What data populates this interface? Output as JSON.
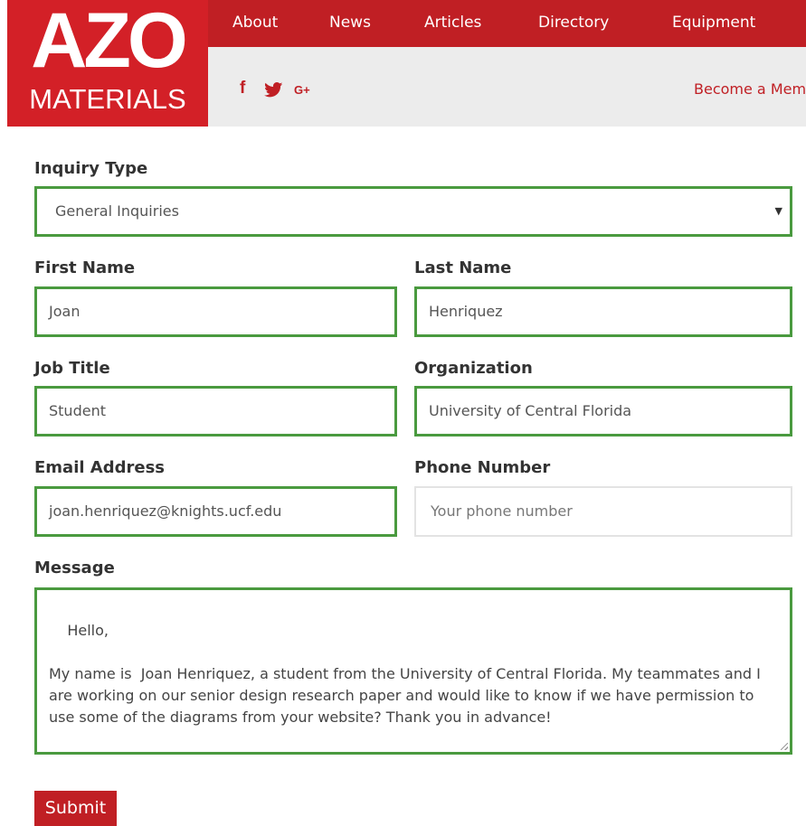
{
  "logo": {
    "brand_top": "AZO",
    "brand_bottom": "MATERIALS"
  },
  "nav": {
    "items": [
      "About",
      "News",
      "Articles",
      "Directory",
      "Equipment"
    ]
  },
  "subbar": {
    "social_icons": [
      "facebook-icon",
      "twitter-icon",
      "google-plus-icon"
    ],
    "facebook_glyph": "f",
    "google_glyph": "G+",
    "become_member": "Become a Mem"
  },
  "form": {
    "inquiry_type": {
      "label": "Inquiry Type",
      "value": "General Inquiries"
    },
    "first_name": {
      "label": "First Name",
      "value": "Joan"
    },
    "last_name": {
      "label": "Last Name",
      "value": "Henriquez"
    },
    "job_title": {
      "label": "Job Title",
      "value": "Student"
    },
    "organization": {
      "label": "Organization",
      "value": "University of Central Florida"
    },
    "email": {
      "label": "Email Address",
      "value": "joan.henriquez@knights.ucf.edu"
    },
    "phone": {
      "label": "Phone Number",
      "value": "",
      "placeholder": "Your phone number"
    },
    "message": {
      "label": "Message",
      "value": "Hello,\n\nMy name is  Joan Henriquez, a student from the University of Central Florida. My teammates and I are working on our senior design research paper and would like to know if we have permission to use some of the diagrams from your website? Thank you in advance!"
    },
    "submit_label": "Submit"
  },
  "colors": {
    "brand_red": "#c01f24",
    "logo_red": "#d32027",
    "valid_border": "#4a9a3f",
    "subbar_gray": "#ececec"
  }
}
